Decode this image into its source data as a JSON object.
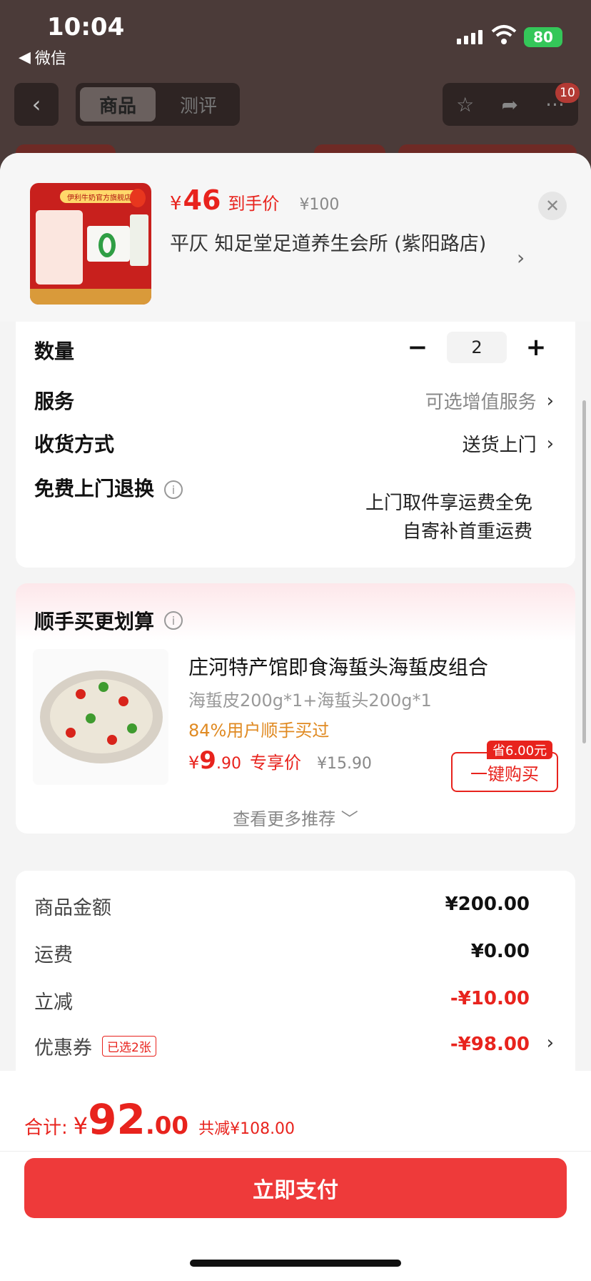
{
  "status_bar": {
    "time": "10:04",
    "back_app": "微信",
    "battery": "80"
  },
  "nav": {
    "tab_active": "商品",
    "tab_inactive": "测评",
    "cart_badge": "10"
  },
  "product": {
    "price_int": "46",
    "price_yen": "¥",
    "price_label": "到手价",
    "original_price": "¥100",
    "store_name": "平仄  知足堂足道养生会所 (紫阳路店)",
    "thumb_banner": "伊利牛奶官方旗舰店"
  },
  "options": {
    "qty_label": "数量",
    "qty_value": "2",
    "qty_minus": "−",
    "qty_plus": "+",
    "service_label": "服务",
    "service_value": "可选增值服务",
    "delivery_label": "收货方式",
    "delivery_value": "送货上门",
    "return_label": "免费上门退换",
    "return_line1": "上门取件享运费全免",
    "return_line2": "自寄补首重运费"
  },
  "bundle": {
    "title": "顺手买更划算",
    "product_title": "庄河特产馆即食海蜇头海蜇皮组合",
    "product_spec": "海蜇皮200g*1+海蜇头200g*1",
    "product_buyers": "84%用户顺手买过",
    "price_yen": "¥",
    "price_int": "9",
    "price_dec": ".90",
    "price_tag": "专享价",
    "original_price": "¥15.90",
    "save_tag": "省6.00元",
    "buy_button": "一键购买",
    "more": "查看更多推荐 ﹀"
  },
  "fees": {
    "goods_label": "商品金额",
    "goods_value": "¥200.00",
    "shipping_label": "运费",
    "shipping_value": "¥0.00",
    "discount_label": "立减",
    "discount_value": "-¥10.00",
    "coupon_label": "优惠券",
    "coupon_tag": "已选2张",
    "coupon_value": "-¥98.00"
  },
  "footer": {
    "total_label": "合计:",
    "total_yen": "¥",
    "total_int": "92",
    "total_dec": ".00",
    "total_off": "共减¥108.00",
    "pay_button": "立即支付"
  },
  "colors": {
    "accent_red": "#e8231d",
    "pay_button": "#ee3a3a",
    "coupon_orange": "#e08a22"
  }
}
